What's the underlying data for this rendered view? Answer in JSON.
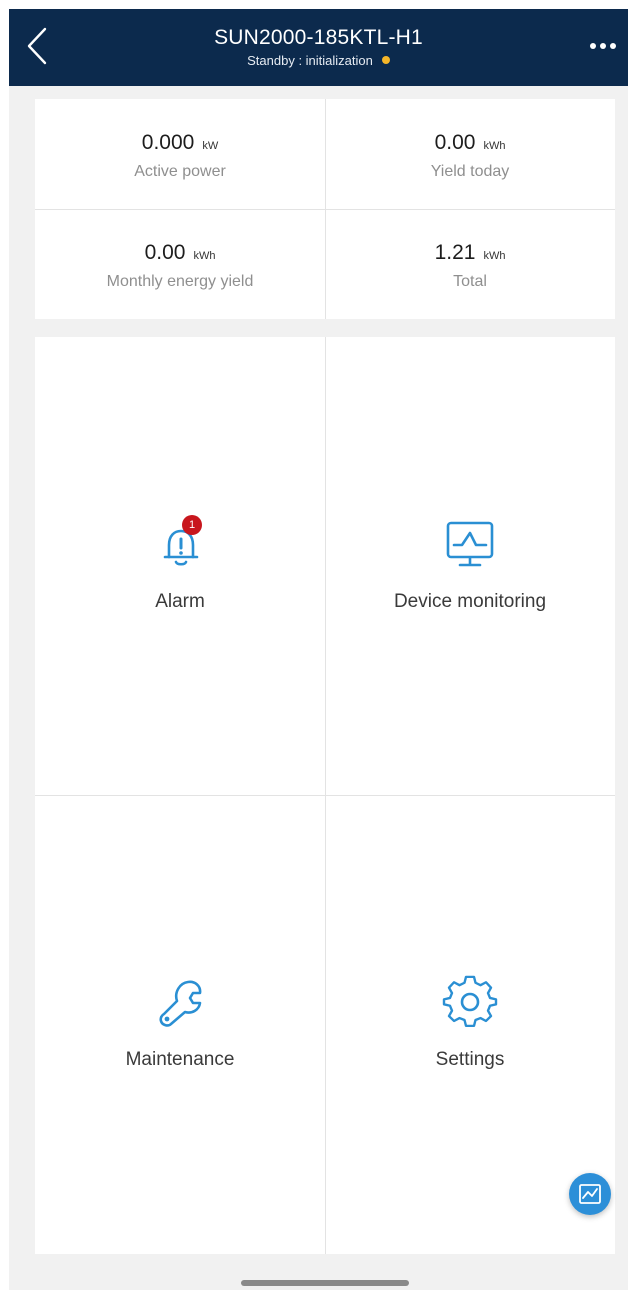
{
  "header": {
    "title": "SUN2000-185KTL-H1",
    "status": "Standby : initialization",
    "status_color": "#f5b629",
    "back_icon": "chevron-left-icon",
    "more_icon": "more-dots-icon"
  },
  "stats": [
    {
      "value": "0.000",
      "unit": "kW",
      "label": "Active power"
    },
    {
      "value": "0.00",
      "unit": "kWh",
      "label": "Yield today"
    },
    {
      "value": "0.00",
      "unit": "kWh",
      "label": "Monthly energy yield"
    },
    {
      "value": "1.21",
      "unit": "kWh",
      "label": "Total"
    }
  ],
  "menu": {
    "alarm": {
      "label": "Alarm",
      "icon": "bell-alert-icon",
      "badge": "1"
    },
    "monitoring": {
      "label": "Device monitoring",
      "icon": "monitor-icon"
    },
    "maintenance": {
      "label": "Maintenance",
      "icon": "wrench-icon"
    },
    "settings": {
      "label": "Settings",
      "icon": "gear-icon"
    }
  },
  "fab": {
    "icon": "trend-chart-icon"
  },
  "colors": {
    "header_bg": "#0c2a4d",
    "icon_blue": "#2a8fd3",
    "badge_red": "#c8161d"
  }
}
